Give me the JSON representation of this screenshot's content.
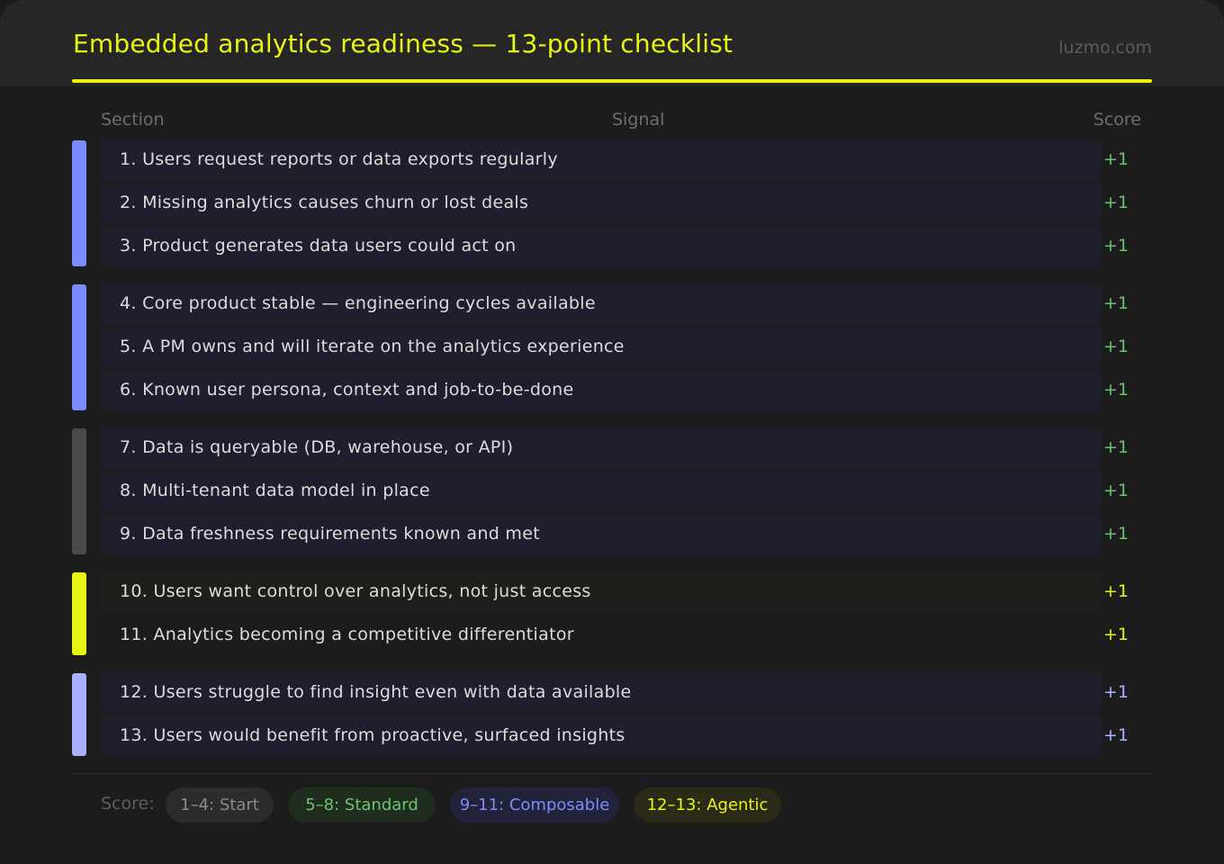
{
  "header": {
    "title": "Embedded analytics readiness — 13-point checklist",
    "site": "luzmo.com",
    "accent_color": "#e8f513"
  },
  "columns": {
    "section": "Section",
    "signal": "Signal",
    "score": "Score"
  },
  "groups": [
    {
      "color": "#7b8cff",
      "rows": [
        0,
        1,
        2
      ]
    },
    {
      "color": "#7b8cff",
      "rows": [
        3,
        4,
        5
      ]
    },
    {
      "color": "#4a4a4a",
      "rows": [
        6,
        7,
        8
      ]
    },
    {
      "color": "#e8f513",
      "rows": [
        9,
        10
      ]
    },
    {
      "color": "#a9b1ff",
      "rows": [
        11,
        12
      ]
    }
  ],
  "rows": [
    {
      "text": "1. Users request reports or data exports regularly",
      "score": "+1",
      "score_color": "#6fc36f"
    },
    {
      "text": "2. Missing analytics causes churn or lost deals",
      "score": "+1",
      "score_color": "#6fc36f"
    },
    {
      "text": "3. Product generates data users could act on",
      "score": "+1",
      "score_color": "#6fc36f"
    },
    {
      "text": "4. Core product stable — engineering cycles available",
      "score": "+1",
      "score_color": "#6fc36f"
    },
    {
      "text": "5. A PM owns and will iterate on the analytics experience",
      "score": "+1",
      "score_color": "#6fc36f"
    },
    {
      "text": "6. Known user persona, context and job-to-be-done",
      "score": "+1",
      "score_color": "#6fc36f"
    },
    {
      "text": "7. Data is queryable (DB, warehouse, or API)",
      "score": "+1",
      "score_color": "#6fc36f"
    },
    {
      "text": "8. Multi-tenant data model in place",
      "score": "+1",
      "score_color": "#6fc36f"
    },
    {
      "text": "9. Data freshness requirements known and met",
      "score": "+1",
      "score_color": "#6fc36f"
    },
    {
      "text": "10. Users want control over analytics, not just access",
      "score": "+1",
      "score_color": "#e8f513"
    },
    {
      "text": "11. Analytics becoming a competitive differentiator",
      "score": "+1",
      "score_color": "#e8f513"
    },
    {
      "text": "12. Users struggle to find insight even with data available",
      "score": "+1",
      "score_color": "#a9b1ff"
    },
    {
      "text": "13. Users would benefit from proactive, surfaced insights",
      "score": "+1",
      "score_color": "#a9b1ff"
    }
  ],
  "legend": {
    "label": "Score:",
    "tiers": [
      {
        "label": "1–4: Start",
        "color": "#8a8a8a",
        "bg": "#2c2c2c"
      },
      {
        "label": "5–8: Standard",
        "color": "#6fc36f",
        "bg": "#1f2d1f"
      },
      {
        "label": "9–11: Composable",
        "color": "#7b8cff",
        "bg": "#22233a"
      },
      {
        "label": "12–13: Agentic",
        "color": "#e8f513",
        "bg": "#2a2a17"
      }
    ]
  }
}
